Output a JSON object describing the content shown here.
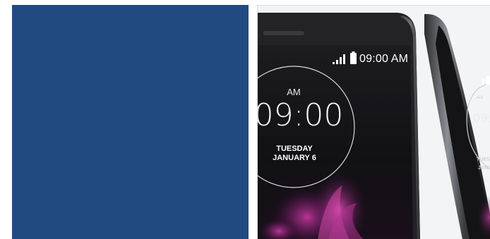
{
  "left_panel": {
    "color": "#214a80"
  },
  "phone_photo": {
    "status_bar": {
      "signal_icon": "signal-bars-icon",
      "battery_icon": "battery-icon",
      "time": "09:00 AM"
    },
    "clock_widget": {
      "meridiem": "AM",
      "time": "09:00",
      "day": "TUESDAY",
      "date": "JANUARY 6"
    }
  }
}
